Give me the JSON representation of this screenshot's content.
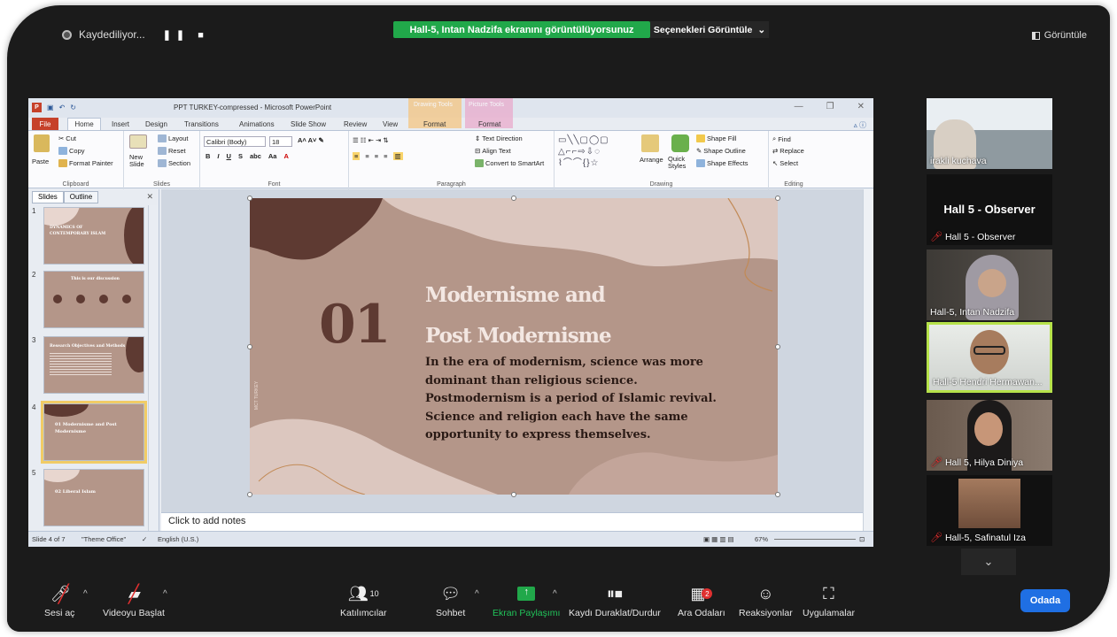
{
  "top": {
    "recording": "Kaydediliyor...",
    "share_banner": "Hall-5, Intan Nadzifa ekranını görüntülüyorsunuz",
    "view_options": "Seçenekleri Görüntüle",
    "view_button": "Görüntüle"
  },
  "ppt": {
    "title": "PPT TURKEY-compressed - Microsoft PowerPoint",
    "context_drawing": "Drawing Tools",
    "context_picture": "Picture Tools",
    "tabs": [
      "File",
      "Home",
      "Insert",
      "Design",
      "Transitions",
      "Animations",
      "Slide Show",
      "Review",
      "View",
      "Format",
      "Format"
    ],
    "clipboard": {
      "paste": "Paste",
      "cut": "Cut",
      "copy": "Copy",
      "format_painter": "Format Painter",
      "label": "Clipboard"
    },
    "slides": {
      "new_slide": "New Slide",
      "layout": "Layout",
      "reset": "Reset",
      "section": "Section",
      "label": "Slides"
    },
    "font": {
      "name": "Calibri (Body)",
      "size": "18",
      "label": "Font"
    },
    "paragraph": {
      "text_direction": "Text Direction",
      "align_text": "Align Text",
      "convert": "Convert to SmartArt",
      "label": "Paragraph"
    },
    "drawing": {
      "arrange": "Arrange",
      "quick_styles": "Quick Styles",
      "shape_fill": "Shape Fill",
      "shape_outline": "Shape Outline",
      "shape_effects": "Shape Effects",
      "label": "Drawing"
    },
    "editing": {
      "find": "Find",
      "replace": "Replace",
      "select": "Select",
      "label": "Editing"
    },
    "pane_tabs": {
      "slides": "Slides",
      "outline": "Outline"
    },
    "slide": {
      "number": "01",
      "title1": "Modernisme and",
      "title2": "Post Modernisme",
      "body": [
        "In the era of modernism, science was more",
        "dominant than religious science.",
        "Postmodernism  is a period of Islamic revival.",
        "Science and religion each have the same",
        "opportunity  to express themselves."
      ],
      "side_text": "MCT TURKEY"
    },
    "thumbs": [
      {
        "num": "1",
        "text": "DYNAMICS OF CONTEMPORARY ISLAM"
      },
      {
        "num": "2",
        "text": "This is our discussion"
      },
      {
        "num": "3",
        "text": "Research Objectives and Methods"
      },
      {
        "num": "4",
        "text": "01  Modernisme and Post Modernisme"
      },
      {
        "num": "5",
        "text": "02  Liberal Islam"
      }
    ],
    "notes_placeholder": "Click to add notes",
    "status": {
      "slide": "Slide 4 of 7",
      "theme": "\"Theme Office\"",
      "lang": "English (U.S.)",
      "zoom": "67%"
    }
  },
  "participants": [
    {
      "name": "irakli kuchava",
      "muted": false
    },
    {
      "name": "Hall 5 - Observer",
      "muted": true
    },
    {
      "name": "Hall-5, Intan Nadzifa",
      "muted": false
    },
    {
      "name": "Hall-5 Hendri Hermawan...",
      "muted": false
    },
    {
      "name": "Hall 5, Hilya Diniya",
      "muted": true
    },
    {
      "name": "Hall-5, Safinatul Iza",
      "muted": true
    }
  ],
  "observer_big": "Hall 5 - Observer",
  "toolbar": {
    "unmute": "Sesi aç",
    "start_video": "Videoyu Başlat",
    "participants": "Katılımcılar",
    "participants_count": "10",
    "chat": "Sohbet",
    "share": "Ekran Paylaşımı",
    "pause_rec": "Kaydı Duraklat/Durdur",
    "breakout": "Ara Odaları",
    "breakout_badge": "2",
    "reactions": "Reaksiyonlar",
    "apps": "Uygulamalar",
    "odada": "Odada"
  },
  "colors": {
    "accent_green": "#21a84a",
    "slide_bg": "#b49689",
    "slide_dark": "#5e3a32",
    "active_border": "#b6e24a"
  }
}
